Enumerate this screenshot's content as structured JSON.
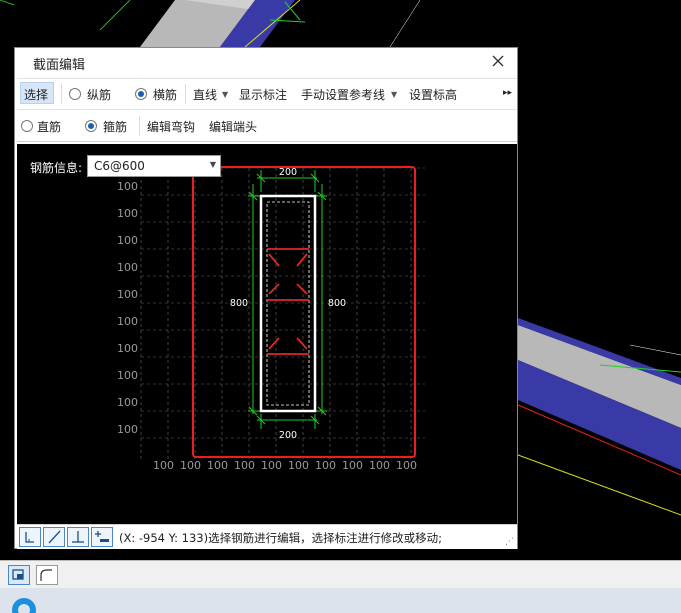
{
  "dialog": {
    "title": "截面编辑"
  },
  "toolbar1": {
    "select": "选择",
    "longitudinal": "纵筋",
    "transverse": "横筋",
    "line": "直线",
    "show_annotation": "显示标注",
    "manual_ref_line": "手动设置参考线",
    "set_elevation": "设置标高",
    "more": "▸▸"
  },
  "toolbar2": {
    "straight": "直筋",
    "stirrup": "箍筋",
    "edit_hook": "编辑弯钩",
    "edit_end": "编辑端头"
  },
  "canvas": {
    "steel_info_label": "钢筋信息:",
    "steel_info_value": "C6@600",
    "dim_top": "200",
    "dim_bottom": "200",
    "dim_left": "800",
    "dim_right": "800",
    "grid_label": "100"
  },
  "status": {
    "text": "(X: -954 Y: 133)选择钢筋进行编辑，选择标注进行修改或移动;"
  },
  "colors": {
    "highlight": "#e82020",
    "dim": "#22cc22",
    "rebar": "#e02828",
    "stirrup": "#ffffff",
    "beam_blue": "#3a3aa6",
    "beam_gray": "#b8b8b8"
  }
}
